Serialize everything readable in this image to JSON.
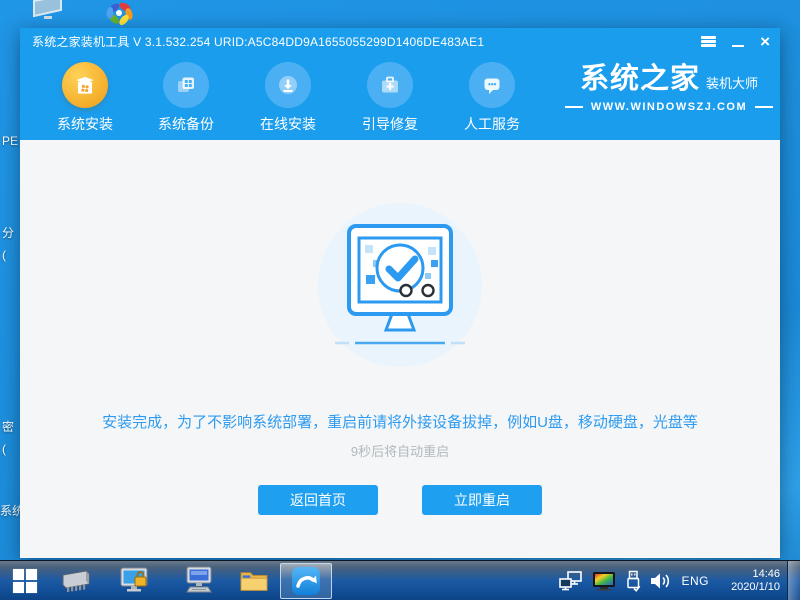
{
  "colors": {
    "accent_blue": "#1b9dee",
    "button_blue": "#1e9fef",
    "active_nav_orange": "#f3a824",
    "message_blue": "#2e9bf0",
    "countdown_gray": "#b2b8bd",
    "desktop_blue": "#1d93e0",
    "success_illustration_blue": "#2b9af0"
  },
  "desktop": {
    "partial_labels": [
      "PE",
      "分",
      "(",
      "密",
      "(",
      "系统"
    ]
  },
  "window": {
    "title": "系统之家装机工具 V 3.1.532.254 URID:A5C84DD9A1655055299D1406DE483AE1",
    "controls": {
      "close_glyph": "×"
    },
    "nav": [
      {
        "label": "系统安装",
        "active": true
      },
      {
        "label": "系统备份",
        "active": false
      },
      {
        "label": "在线安装",
        "active": false
      },
      {
        "label": "引导修复",
        "active": false
      },
      {
        "label": "人工服务",
        "active": false
      }
    ],
    "logo": {
      "brand": "系统之家",
      "sub": "装机大师",
      "site": "WWW.WINDOWSZJ.COM"
    },
    "main": {
      "message": "安装完成，为了不影响系统部署，重启前请将外接设备拔掉，例如U盘，移动硬盘，光盘等",
      "countdown": "9秒后将自动重启",
      "buttons": [
        {
          "label": "返回首页"
        },
        {
          "label": "立即重启"
        }
      ]
    }
  },
  "taskbar": {
    "tray": {
      "language": "ENG",
      "time": "14:46",
      "date": "2020/1/10"
    }
  },
  "icons": {
    "menu-icon": "three-bars",
    "minimize-icon": "dash",
    "close-icon": "x-cross",
    "nav-install-icon": "package-box",
    "nav-backup-icon": "stacked-windows",
    "nav-online-icon": "download-circle",
    "nav-repair-icon": "toolbox-plus",
    "nav-service-icon": "chat-bubble",
    "success-monitor-illustration": "monitor-with-checkmark",
    "start-icon": "windows-logo",
    "ram-chip-icon": "memory-chip",
    "screen-lock-icon": "monitor-with-lock",
    "remote-computer-icon": "monitor-with-keyboard",
    "file-explorer-icon": "yellow-folder",
    "app-swoosh-icon": "blue-swoosh-logo",
    "network-icon": "dual-monitors",
    "display-color-icon": "rainbow-monitor",
    "usb-icon": "usb-plug",
    "volume-icon": "speaker-waves",
    "desktop-computer-icon": "tilted-monitor",
    "desktop-flower-icon": "color-flower"
  }
}
